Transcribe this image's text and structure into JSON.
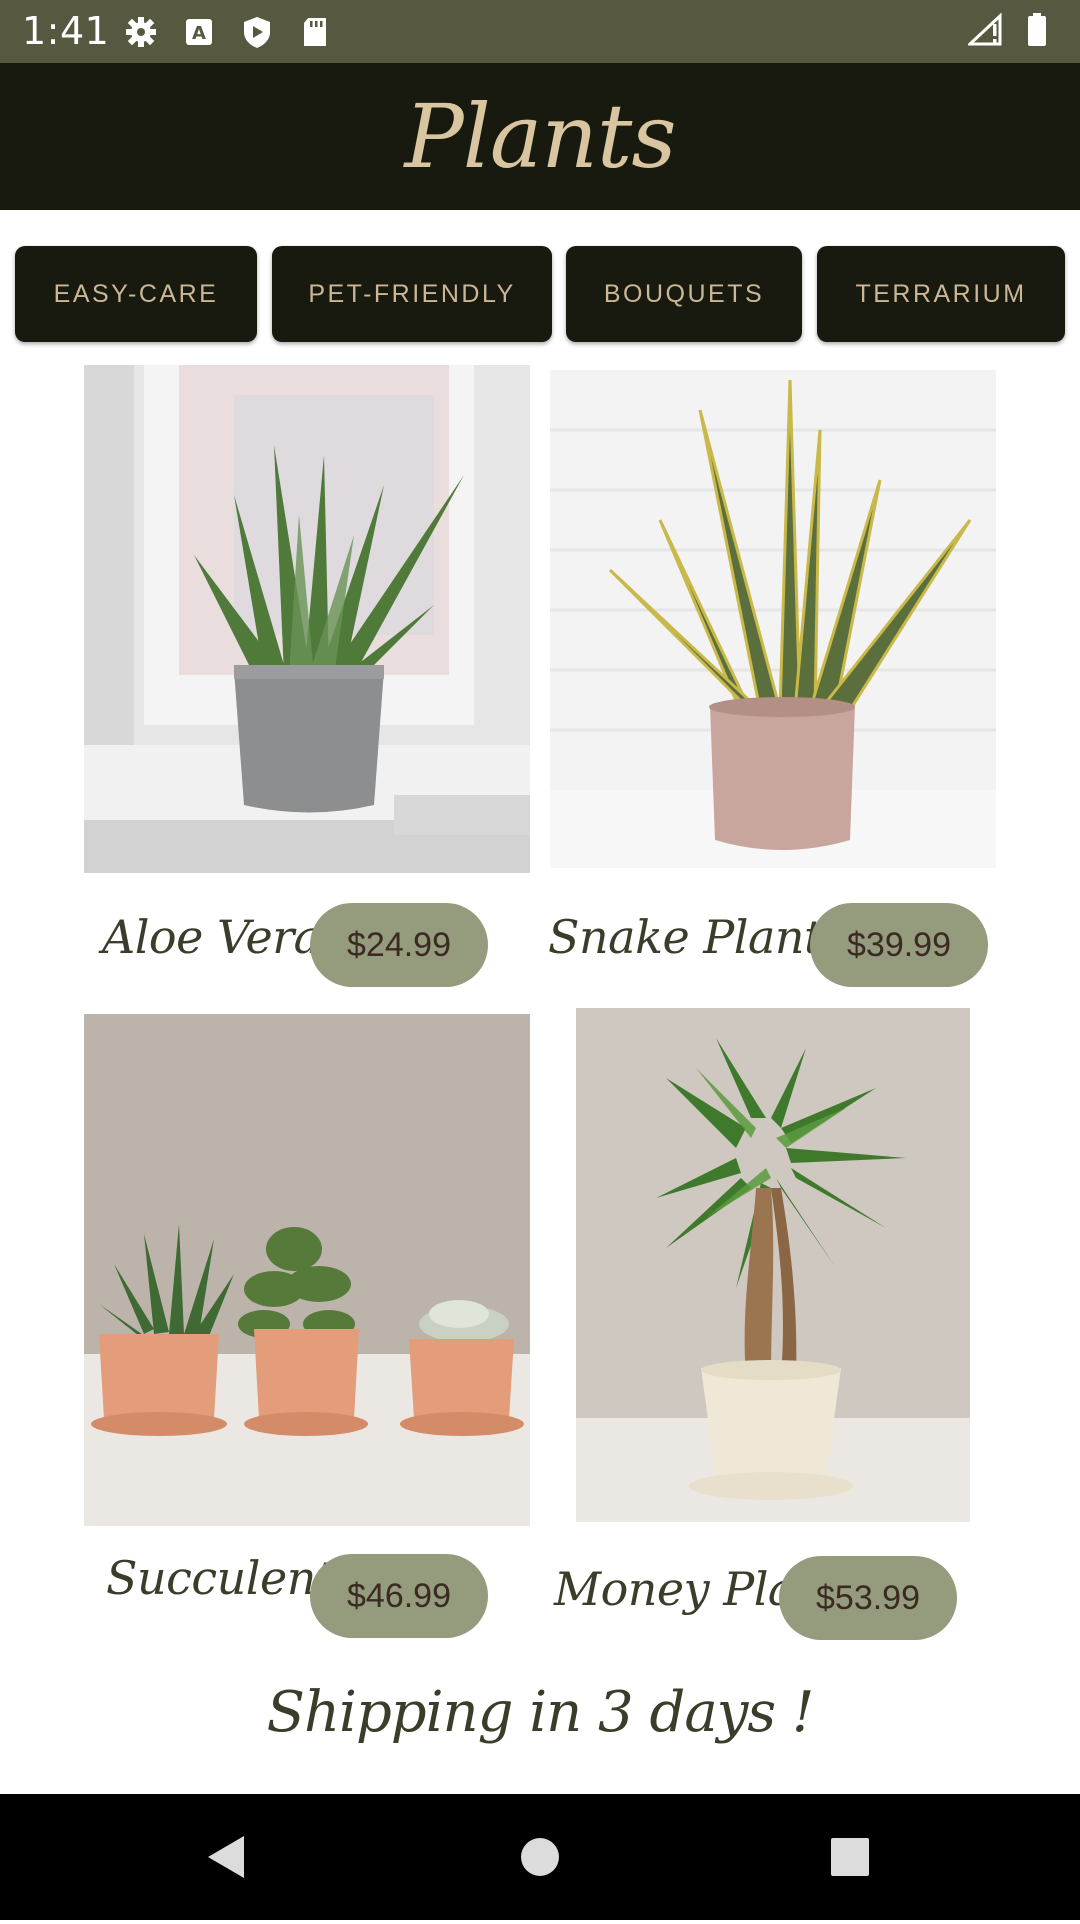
{
  "status_bar": {
    "time": "1:41",
    "icons_left": [
      "gear-icon",
      "text-a-icon",
      "play-shield-icon",
      "sd-card-icon"
    ],
    "icons_right": [
      "signal-icon",
      "battery-icon"
    ]
  },
  "header": {
    "title": "Plants"
  },
  "categories": [
    {
      "label": "EASY-CARE"
    },
    {
      "label": "PET-FRIENDLY"
    },
    {
      "label": "BOUQUETS"
    },
    {
      "label": "TERRARIUM"
    }
  ],
  "plants": [
    {
      "name": "Aloe Vera",
      "price": "$24.99"
    },
    {
      "name": "Snake Plant",
      "price": "$39.99"
    },
    {
      "name": "Succulent",
      "price": "$46.99"
    },
    {
      "name": "Money Plant",
      "price": "$53.99"
    }
  ],
  "footer": {
    "shipping": "Shipping in 3 days !"
  },
  "nav_bar": {
    "buttons": [
      "back-icon",
      "home-icon",
      "recents-icon"
    ]
  },
  "colors": {
    "status_bar": "#56583f",
    "header_bg": "#18190f",
    "title": "#d9c5a0",
    "category_text": "#cbb795",
    "price_pill": "#959b7d",
    "price_text": "#3a2a22",
    "script_text": "#3c3c2a"
  }
}
